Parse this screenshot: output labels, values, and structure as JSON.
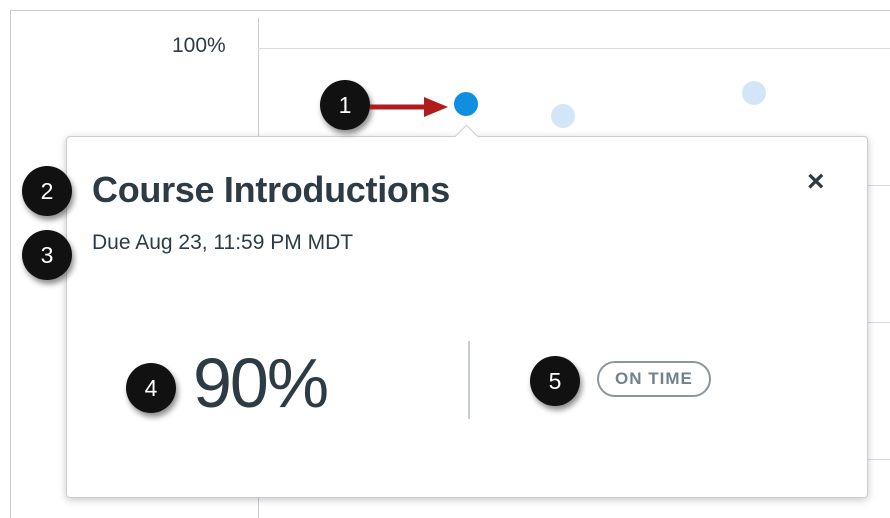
{
  "chart": {
    "y_tick_label": "100%"
  },
  "popover": {
    "title": "Course Introductions",
    "due": "Due Aug 23, 11:59 PM MDT",
    "close_label": "×",
    "score": "90%",
    "status": "ON TIME"
  },
  "callouts": [
    "1",
    "2",
    "3",
    "4",
    "5"
  ],
  "colors": {
    "active_point": "#0e8fe0",
    "faded_point": "#d3e6f8",
    "text": "#2d3b45",
    "callout_bg": "#111111",
    "arrow": "#b01c1c"
  }
}
